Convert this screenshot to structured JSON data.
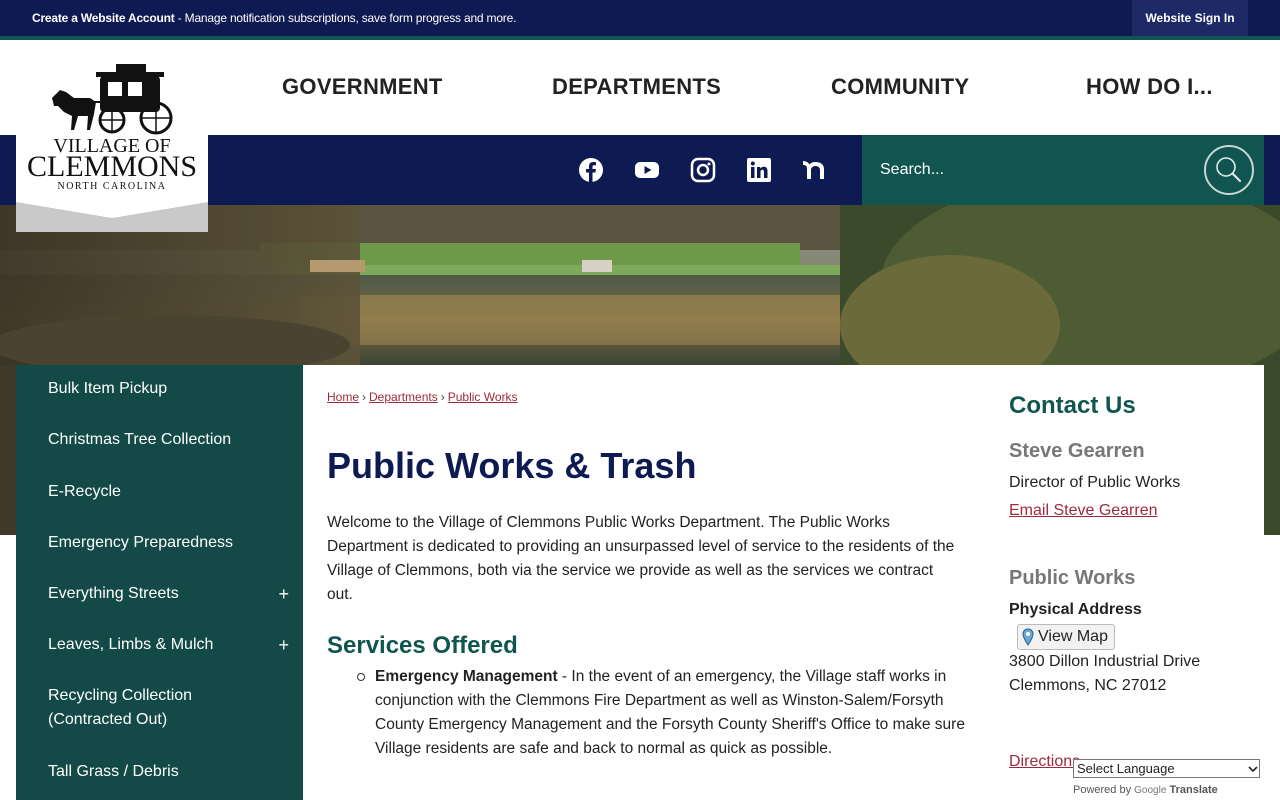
{
  "topbar": {
    "create_account": "Create a Website Account",
    "message": " - Manage notification subscriptions, save form progress and more.",
    "sign_in": "Website Sign In"
  },
  "logo": {
    "line1": "VILLAGE OF",
    "line2": "CLEMMONS",
    "line3": "NORTH CAROLINA"
  },
  "nav": [
    {
      "label": "GOVERNMENT"
    },
    {
      "label": "DEPARTMENTS"
    },
    {
      "label": "COMMUNITY"
    },
    {
      "label": "HOW DO I..."
    }
  ],
  "social": [
    "facebook-icon",
    "youtube-icon",
    "instagram-icon",
    "linkedin-icon",
    "nextdoor-icon"
  ],
  "search": {
    "placeholder": "Search..."
  },
  "sidebar": {
    "items": [
      {
        "label": "Bulk Item Pickup",
        "expandable": false
      },
      {
        "label": "Christmas Tree Collection",
        "expandable": false
      },
      {
        "label": "E-Recycle",
        "expandable": false
      },
      {
        "label": "Emergency Preparedness",
        "expandable": false
      },
      {
        "label": "Everything Streets",
        "expandable": true
      },
      {
        "label": "Leaves, Limbs & Mulch",
        "expandable": true
      },
      {
        "label": "Recycling Collection (Contracted Out)",
        "expandable": false
      },
      {
        "label": "Tall Grass / Debris",
        "expandable": false
      }
    ],
    "expand_symbol": "+"
  },
  "breadcrumb": {
    "items": [
      "Home",
      "Departments",
      "Public Works"
    ],
    "separator": "›"
  },
  "main": {
    "title": "Public Works & Trash",
    "intro": "Welcome to the Village of Clemmons Public Works Department. The Public Works Department is dedicated to providing an unsurpassed level of service to the residents of the Village of Clemmons, both via the service we provide as well as the services we contract out.",
    "services_heading": "Services Offered",
    "services": [
      {
        "name": "Emergency Management",
        "text": " - In the event of an emergency, the Village staff works in conjunction with the Clemmons Fire Department as well as Winston-Salem/Forsyth County Emergency Management and the Forsyth County Sheriff's Office to make sure Village residents are safe and back to normal as quick as possible."
      }
    ]
  },
  "contact": {
    "heading": "Contact Us",
    "name": "Steve Gearren",
    "role": "Director of Public Works",
    "email_label": "Email Steve Gearren",
    "department": "Public Works",
    "address_label": "Physical Address",
    "view_map": "View Map",
    "address_line1": "3800 Dillon Industrial Drive",
    "address_line2": "Clemmons, NC 27012",
    "directions": "Directions"
  },
  "translate": {
    "select_label": "Select Language",
    "powered_by": "Powered by",
    "google": "Google",
    "translate": "Translate"
  },
  "colors": {
    "navy": "#0e1a52",
    "teal": "#10554f",
    "sidebar": "#134a47",
    "link": "#9e2a3c"
  }
}
